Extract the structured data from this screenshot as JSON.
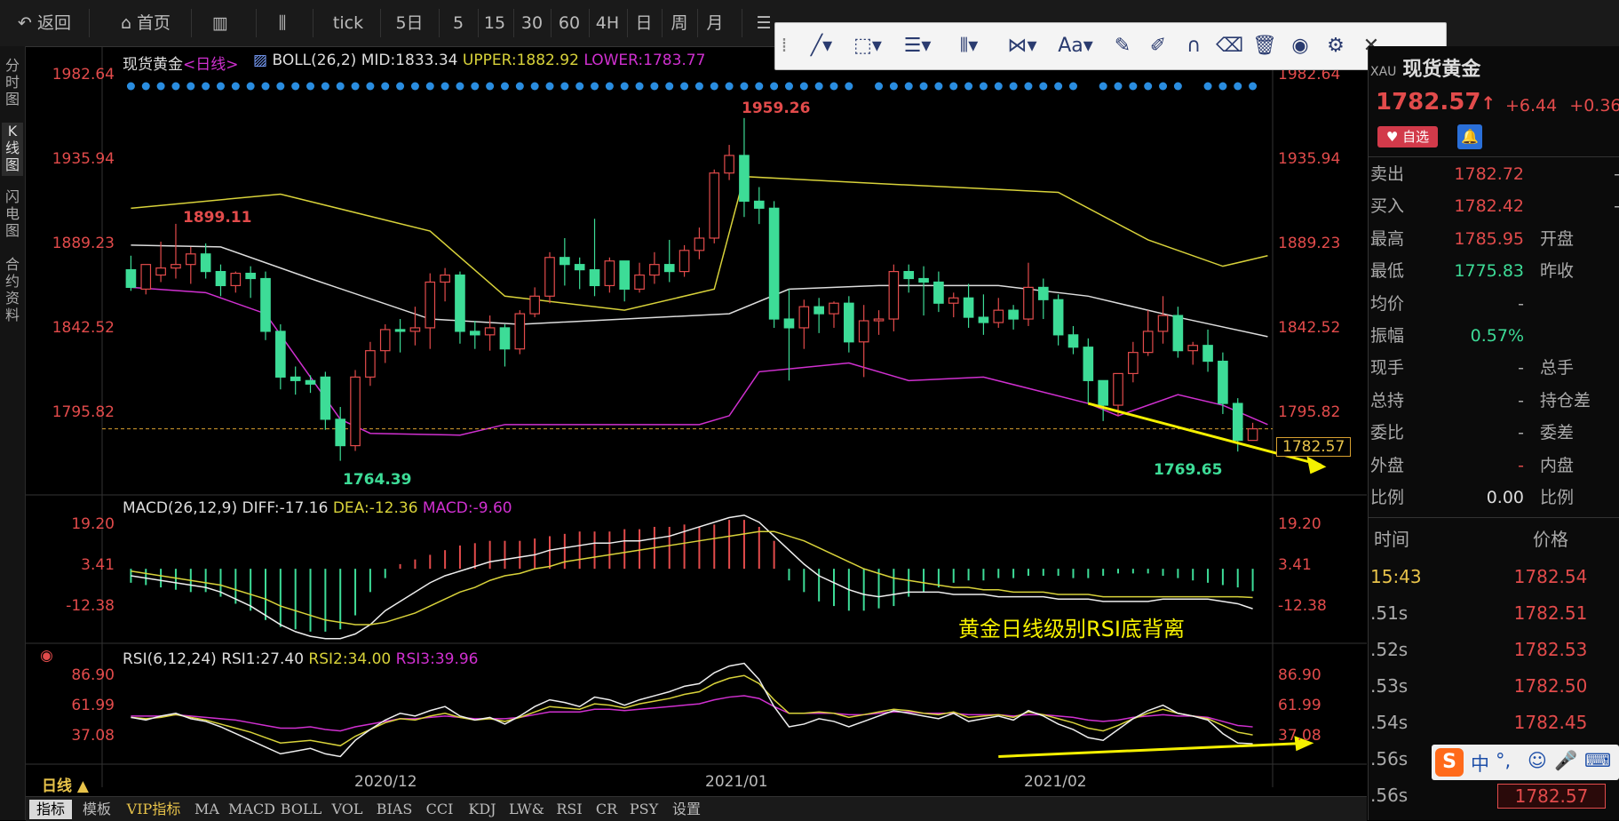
{
  "toolbar": {
    "back": "返回",
    "home": "首页",
    "tick": "tick",
    "periods": [
      "5日",
      "5",
      "15",
      "30",
      "60",
      "4H",
      "日",
      "周",
      "月"
    ]
  },
  "left_tabs": [
    "分时图",
    "K线图",
    "闪电图",
    "合约资料"
  ],
  "chart": {
    "title": "现货黄金",
    "period": "<日线>",
    "boll": {
      "label": "BOLL(26,2)",
      "mid": "MID:1833.34",
      "upper": "UPPER:1882.92",
      "lower": "LOWER:1783.77"
    },
    "price_ticks": [
      "1982.64",
      "1935.94",
      "1889.23",
      "1842.52",
      "1795.82"
    ],
    "last_price_tag": "1782.57",
    "annotations": {
      "high": "1959.26",
      "left_high": "1899.11",
      "low": "1764.39",
      "recent_low": "1769.65"
    },
    "macd": {
      "label": "MACD(26,12,9)",
      "diff": "DIFF:-17.16",
      "dea": "DEA:-12.36",
      "macd": "MACD:-9.60",
      "ticks": [
        "19.20",
        "3.41",
        "-12.38"
      ]
    },
    "rsi": {
      "label": "RSI(6,12,24)",
      "rsi1": "RSI1:27.40",
      "rsi2": "RSI2:34.00",
      "rsi3": "RSI3:39.96",
      "ticks": [
        "86.90",
        "61.99",
        "37.08"
      ]
    },
    "divergence_note": "黄金日线级别RSI底背离",
    "dates": [
      "2020/12",
      "2021/01",
      "2021/02"
    ],
    "period_badge": "日线",
    "colors": {
      "up": "#e24b4b",
      "down": "#3ddc97",
      "upper": "#d8d23a",
      "mid": "#dddddd",
      "lower": "#d030d0",
      "arrow": "#f5f000"
    }
  },
  "chart_data": {
    "type": "candlestick",
    "candles": [
      [
        1873,
        1881,
        1863,
        1861
      ],
      [
        1862,
        1870,
        1876,
        1859
      ],
      [
        1870,
        1889,
        1874,
        1866
      ],
      [
        1874,
        1899.11,
        1876,
        1868
      ],
      [
        1876,
        1886,
        1882,
        1865
      ],
      [
        1882,
        1888,
        1872,
        1868
      ],
      [
        1872,
        1876,
        1864,
        1858
      ],
      [
        1864,
        1872,
        1871,
        1860
      ],
      [
        1871,
        1875,
        1868,
        1857
      ],
      [
        1868,
        1872,
        1838,
        1833
      ],
      [
        1838,
        1842,
        1812,
        1805
      ],
      [
        1812,
        1818,
        1810,
        1802
      ],
      [
        1810,
        1813,
        1808,
        1803
      ],
      [
        1812,
        1815,
        1788,
        1782
      ],
      [
        1788,
        1795,
        1773,
        1764.39
      ],
      [
        1773,
        1816,
        1812,
        1770
      ],
      [
        1812,
        1832,
        1827,
        1807
      ],
      [
        1827,
        1842,
        1839,
        1820
      ],
      [
        1839,
        1845,
        1838,
        1826
      ],
      [
        1838,
        1852,
        1840,
        1830
      ],
      [
        1840,
        1871,
        1866,
        1828
      ],
      [
        1866,
        1874,
        1870,
        1855
      ],
      [
        1870,
        1872,
        1838,
        1831
      ],
      [
        1838,
        1844,
        1836,
        1828
      ],
      [
        1836,
        1847,
        1840,
        1827
      ],
      [
        1840,
        1842,
        1828,
        1818
      ],
      [
        1828,
        1850,
        1848,
        1825
      ],
      [
        1848,
        1863,
        1858,
        1846
      ],
      [
        1858,
        1883,
        1880,
        1854
      ],
      [
        1880,
        1891,
        1876,
        1864
      ],
      [
        1876,
        1880,
        1873,
        1862
      ],
      [
        1873,
        1902,
        1864,
        1858
      ],
      [
        1864,
        1880,
        1878,
        1860
      ],
      [
        1878,
        1878,
        1862,
        1855
      ],
      [
        1862,
        1877,
        1870,
        1860
      ],
      [
        1870,
        1883,
        1876,
        1865
      ],
      [
        1876,
        1890,
        1872,
        1866
      ],
      [
        1872,
        1887,
        1884,
        1869
      ],
      [
        1884,
        1897,
        1891,
        1879
      ],
      [
        1891,
        1930,
        1928,
        1888
      ],
      [
        1928,
        1944,
        1938,
        1924
      ],
      [
        1938,
        1959.26,
        1912,
        1903
      ],
      [
        1912,
        1920,
        1908,
        1899
      ],
      [
        1908,
        1912,
        1845,
        1840
      ],
      [
        1845,
        1862,
        1840,
        1810
      ],
      [
        1840,
        1856,
        1852,
        1828
      ],
      [
        1852,
        1857,
        1848,
        1837
      ],
      [
        1848,
        1855,
        1854,
        1840
      ],
      [
        1854,
        1858,
        1832,
        1826
      ],
      [
        1832,
        1853,
        1844,
        1812
      ],
      [
        1844,
        1850,
        1845,
        1836
      ],
      [
        1845,
        1876,
        1872,
        1838
      ],
      [
        1872,
        1876,
        1868,
        1860
      ],
      [
        1868,
        1875,
        1866,
        1847
      ],
      [
        1866,
        1872,
        1854,
        1849
      ],
      [
        1854,
        1860,
        1857,
        1846
      ],
      [
        1857,
        1865,
        1846,
        1840
      ],
      [
        1846,
        1859,
        1843,
        1836
      ],
      [
        1843,
        1857,
        1850,
        1840
      ],
      [
        1850,
        1853,
        1845,
        1839
      ],
      [
        1845,
        1877,
        1863,
        1841
      ],
      [
        1863,
        1868,
        1856,
        1845
      ],
      [
        1856,
        1859,
        1836,
        1830
      ],
      [
        1836,
        1841,
        1829,
        1825
      ],
      [
        1829,
        1834,
        1810,
        1797
      ],
      [
        1810,
        1805,
        1796,
        1787
      ],
      [
        1796,
        1808,
        1814,
        1790
      ],
      [
        1814,
        1832,
        1826,
        1809
      ],
      [
        1826,
        1850,
        1838,
        1824
      ],
      [
        1838,
        1858,
        1847,
        1831
      ],
      [
        1847,
        1852,
        1827,
        1823
      ],
      [
        1827,
        1832,
        1830,
        1819
      ],
      [
        1830,
        1839,
        1821,
        1815
      ],
      [
        1821,
        1826,
        1797,
        1791
      ],
      [
        1797,
        1800,
        1776,
        1769.65
      ],
      [
        1776,
        1786,
        1782.57,
        1776
      ]
    ],
    "boll_upper_pts": [
      [
        0,
        1908
      ],
      [
        10,
        1916
      ],
      [
        20,
        1895
      ],
      [
        25,
        1858
      ],
      [
        33,
        1850
      ],
      [
        39,
        1862
      ],
      [
        41,
        1926
      ],
      [
        50,
        1922
      ],
      [
        62,
        1917
      ],
      [
        68,
        1890
      ],
      [
        73,
        1875
      ],
      [
        76,
        1881
      ]
    ],
    "boll_mid_pts": [
      [
        0,
        1887
      ],
      [
        6,
        1886
      ],
      [
        12,
        1868
      ],
      [
        20,
        1845
      ],
      [
        26,
        1842
      ],
      [
        40,
        1848
      ],
      [
        44,
        1862
      ],
      [
        50,
        1864
      ],
      [
        58,
        1864
      ],
      [
        64,
        1858
      ],
      [
        70,
        1846
      ],
      [
        76,
        1835
      ]
    ],
    "boll_lower_pts": [
      [
        0,
        1863
      ],
      [
        5,
        1860
      ],
      [
        9,
        1848
      ],
      [
        14,
        1788
      ],
      [
        16,
        1780
      ],
      [
        22,
        1779
      ],
      [
        25,
        1785
      ],
      [
        38,
        1785
      ],
      [
        40,
        1790
      ],
      [
        42,
        1815
      ],
      [
        48,
        1820
      ],
      [
        52,
        1810
      ],
      [
        57,
        1812
      ],
      [
        64,
        1797
      ],
      [
        66,
        1790
      ],
      [
        70,
        1802
      ],
      [
        73,
        1796
      ],
      [
        76,
        1785
      ]
    ],
    "macd_hist": [
      -6,
      -7,
      -8,
      -9,
      -10,
      -10,
      -12,
      -15,
      -18,
      -22,
      -25,
      -26,
      -27,
      -27,
      -26,
      -20,
      -10,
      -4,
      2,
      4,
      6,
      8,
      10,
      11,
      12,
      12,
      12,
      13,
      14,
      15,
      16,
      16,
      16,
      17,
      17,
      18,
      18,
      19,
      18,
      19,
      21,
      21,
      18,
      12,
      -5,
      -10,
      -14,
      -16,
      -18,
      -18,
      -17,
      -16,
      -12,
      -10,
      -8,
      -6,
      -5,
      -5,
      -4,
      -4,
      -3,
      -3,
      -3,
      -4,
      -4,
      -3,
      -2,
      -2,
      -2,
      -3,
      -4,
      -5,
      -6,
      -7,
      -8,
      -9.6
    ],
    "macd_diff": [
      -3,
      -4,
      -5,
      -6,
      -7,
      -8,
      -10,
      -13,
      -16,
      -20,
      -24,
      -27,
      -29,
      -30,
      -30,
      -28,
      -24,
      -18,
      -14,
      -10,
      -6,
      -3,
      -1,
      1,
      3,
      4,
      5,
      6,
      8,
      9,
      10,
      11,
      11,
      12,
      12,
      13,
      14,
      16,
      18,
      20,
      22,
      23,
      20,
      14,
      8,
      2,
      -3,
      -6,
      -9,
      -11,
      -12,
      -11,
      -10,
      -10,
      -10,
      -11,
      -11,
      -11,
      -12,
      -12,
      -12,
      -12,
      -13,
      -13,
      -13,
      -14,
      -14,
      -14,
      -14,
      -13,
      -13,
      -13,
      -13,
      -14,
      -15,
      -17.16
    ],
    "macd_dea": [
      -1,
      -2,
      -3,
      -4,
      -5,
      -6,
      -7,
      -9,
      -11,
      -13,
      -16,
      -18,
      -20,
      -22,
      -23,
      -24,
      -24,
      -23,
      -21,
      -19,
      -16,
      -13,
      -10,
      -8,
      -5,
      -3,
      -2,
      0,
      1,
      3,
      4,
      5,
      6,
      7,
      8,
      9,
      10,
      11,
      12,
      13,
      14,
      15,
      16,
      16,
      14,
      12,
      9,
      6,
      3,
      0,
      -2,
      -4,
      -5,
      -6,
      -7,
      -8,
      -8,
      -9,
      -9,
      -10,
      -10,
      -10,
      -11,
      -11,
      -11,
      -12,
      -12,
      -12,
      -12,
      -12,
      -12,
      -12,
      -12,
      -12,
      -12,
      -12.36
    ],
    "rsi1": [
      47,
      45,
      48,
      50,
      46,
      44,
      40,
      35,
      30,
      25,
      20,
      22,
      24,
      20,
      18,
      30,
      38,
      45,
      50,
      48,
      52,
      55,
      48,
      45,
      47,
      42,
      48,
      55,
      60,
      58,
      55,
      62,
      60,
      56,
      60,
      63,
      66,
      70,
      72,
      80,
      85,
      87,
      75,
      55,
      40,
      42,
      46,
      44,
      40,
      44,
      48,
      52,
      50,
      48,
      46,
      50,
      44,
      46,
      48,
      45,
      52,
      48,
      42,
      38,
      32,
      30,
      38,
      46,
      52,
      56,
      50,
      48,
      45,
      35,
      28,
      27.4
    ],
    "rsi2": [
      47,
      46,
      47,
      49,
      47,
      45,
      42,
      39,
      36,
      32,
      28,
      29,
      30,
      28,
      26,
      33,
      38,
      43,
      46,
      45,
      48,
      50,
      47,
      45,
      46,
      44,
      47,
      51,
      55,
      54,
      53,
      57,
      56,
      54,
      57,
      59,
      61,
      64,
      66,
      72,
      76,
      78,
      72,
      60,
      50,
      50,
      51,
      50,
      47,
      49,
      51,
      53,
      52,
      50,
      49,
      51,
      47,
      48,
      49,
      47,
      51,
      49,
      46,
      43,
      39,
      37,
      41,
      46,
      50,
      53,
      50,
      48,
      46,
      41,
      36,
      34.0
    ],
    "rsi3": [
      48,
      48,
      48,
      49,
      48,
      47,
      46,
      45,
      43,
      41,
      39,
      39,
      40,
      38,
      37,
      40,
      42,
      44,
      46,
      46,
      47,
      48,
      47,
      46,
      46,
      46,
      47,
      49,
      51,
      51,
      51,
      53,
      53,
      52,
      53,
      54,
      55,
      56,
      57,
      60,
      62,
      63,
      61,
      55,
      50,
      50,
      50,
      50,
      49,
      49,
      50,
      51,
      51,
      50,
      50,
      50,
      49,
      49,
      49,
      48,
      49,
      49,
      48,
      47,
      45,
      44,
      45,
      47,
      48,
      49,
      48,
      48,
      47,
      44,
      41,
      39.96
    ],
    "x_dates": [
      "2020/12",
      "2021/01",
      "2021/02"
    ]
  },
  "right_panel": {
    "header_code": "XAU",
    "name": "现货黄金",
    "price": "1782.57",
    "arrow": "↑",
    "change": "+6.44",
    "change_pct": "+0.36",
    "fav_label": "自选",
    "rows": [
      {
        "k": "卖出",
        "v": "1782.72",
        "vc": "#e24b4b",
        "k2": "",
        "v2": "-"
      },
      {
        "k": "买入",
        "v": "1782.42",
        "vc": "#e24b4b",
        "k2": "",
        "v2": "-"
      },
      {
        "k": "最高",
        "v": "1785.95",
        "vc": "#e24b4b",
        "k2": "开盘",
        "v2": ""
      },
      {
        "k": "最低",
        "v": "1775.83",
        "vc": "#3ddc97",
        "k2": "昨收",
        "v2": ""
      },
      {
        "k": "均价",
        "v": "-",
        "vc": "#aaa",
        "k2": "",
        "v2": ""
      },
      {
        "k": "振幅",
        "v": "0.57%",
        "vc": "#3ddc97",
        "k2": "",
        "v2": ""
      },
      {
        "k": "现手",
        "v": "-",
        "vc": "#aaa",
        "k2": "总手",
        "v2": ""
      },
      {
        "k": "总持",
        "v": "-",
        "vc": "#aaa",
        "k2": "持仓差",
        "v2": ""
      },
      {
        "k": "委比",
        "v": "-",
        "vc": "#aaa",
        "k2": "委差",
        "v2": ""
      },
      {
        "k": "外盘",
        "v": "-",
        "vc": "#e24b4b",
        "k2": "内盘",
        "v2": ""
      },
      {
        "k": "比例",
        "v": "0.00",
        "vc": "#ddd",
        "k2": "比例",
        "v2": ""
      }
    ],
    "ticks_header": {
      "time": "时间",
      "price": "价格"
    },
    "ticks": [
      {
        "t": "15:43",
        "p": "1782.54"
      },
      {
        "t": ".51s",
        "p": "1782.51"
      },
      {
        "t": ".52s",
        "p": "1782.53"
      },
      {
        "t": ".53s",
        "p": "1782.50"
      },
      {
        "t": ".54s",
        "p": "1782.45"
      },
      {
        "t": ".56s",
        "p": ""
      },
      {
        "t": ".56s",
        "p": "1782.57"
      }
    ]
  },
  "bottom_tabs": [
    "指标",
    "模板",
    "VIP指标",
    "MA",
    "MACD",
    "BOLL",
    "VOL",
    "BIAS",
    "CCI",
    "KDJ",
    "LW&",
    "RSI",
    "CR",
    "PSY",
    "设置"
  ],
  "ime": {
    "lang": "中"
  }
}
